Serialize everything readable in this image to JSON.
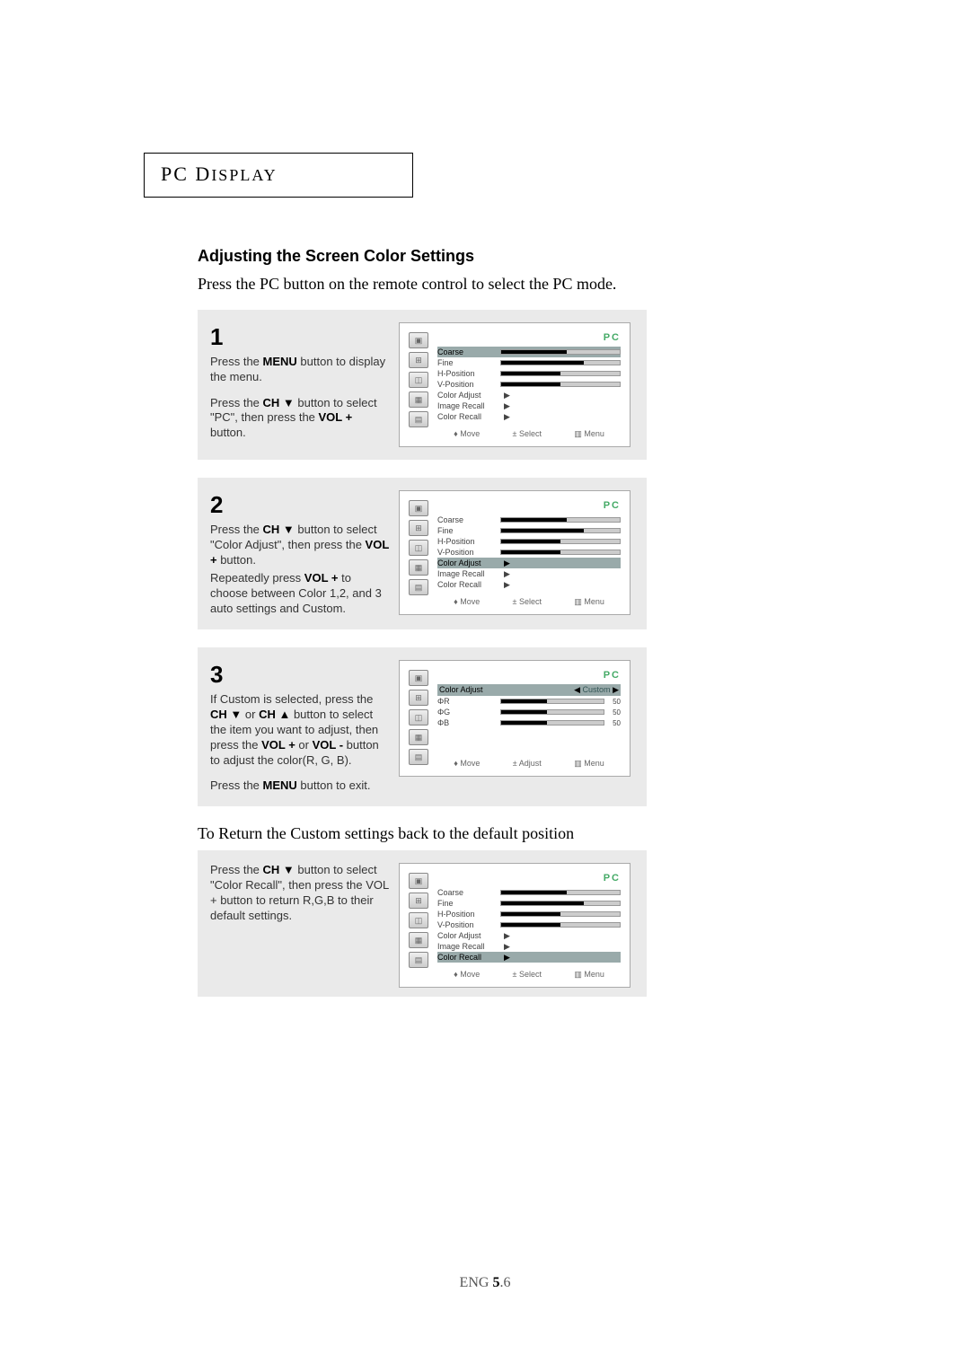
{
  "header": {
    "title_a": "PC",
    "title_b": " D",
    "title_c": "ISPLAY"
  },
  "section_title": "Adjusting the Screen Color Settings",
  "intro": "Press the PC button on the remote control to select the PC mode.",
  "steps": {
    "s1": {
      "num": "1",
      "p1a": "Press the ",
      "p1b": "MENU",
      "p1c": " button to display the menu.",
      "p2a": "Press the ",
      "p2b": "CH ▼",
      "p2c": " button to select \"PC\", then press the ",
      "p2d": "VOL +",
      "p2e": " button."
    },
    "s2": {
      "num": "2",
      "p1a": "Press the ",
      "p1b": "CH ▼",
      "p1c": " button to select \"Color Adjust\", then press the ",
      "p1d": "VOL +",
      "p1e": " button.",
      "p2a": "Repeatedly press ",
      "p2b": "VOL +",
      "p2c": " to choose between Color 1,2, and 3 auto settings and Custom."
    },
    "s3": {
      "num": "3",
      "p1a": "If Custom is selected, press the ",
      "p1b": "CH ▼",
      "p1c": " or ",
      "p1d": "CH ▲",
      "p1e": " button to select the item you want to adjust, then press the ",
      "p1f": "VOL +",
      "p1g": " or ",
      "p1h": "VOL -",
      "p1i": " button to adjust  the color(R, G, B).",
      "p2a": "Press the ",
      "p2b": "MENU",
      "p2c": " button to exit."
    },
    "s4": {
      "p1a": "Press the ",
      "p1b": "CH ▼",
      "p1c": " button to select \"Color Recall\", then press the VOL + button to return R,G,B to their default settings."
    }
  },
  "return_line": "To Return the Custom settings back to the default position",
  "osd_common": {
    "pc": "PC",
    "items": {
      "coarse": "Coarse",
      "fine": "Fine",
      "hpos": "H-Position",
      "vpos": "V-Position",
      "cadj": "Color Adjust",
      "irecall": "Image Recall",
      "crecall": "Color Recall"
    },
    "foot": {
      "move": "Move",
      "select": "Select",
      "adjust": "Adjust",
      "menu": "Menu"
    },
    "sym": {
      "updown": "♦",
      "pm": "±",
      "menuicon": "▥"
    }
  },
  "osd3": {
    "title": "Color Adjust",
    "mode_l": "◀",
    "mode": "Custom",
    "mode_r": "▶",
    "rows": [
      {
        "label": "ΦR",
        "val": "50"
      },
      {
        "label": "ΦG",
        "val": "50"
      },
      {
        "label": "ΦB",
        "val": "50"
      }
    ]
  },
  "bars": {
    "coarse": 55,
    "fine": 70,
    "hpos": 50,
    "vpos": 50,
    "rgb": 45
  },
  "footer": {
    "lang": "ENG ",
    "ch": "5",
    "pg": ".6"
  }
}
